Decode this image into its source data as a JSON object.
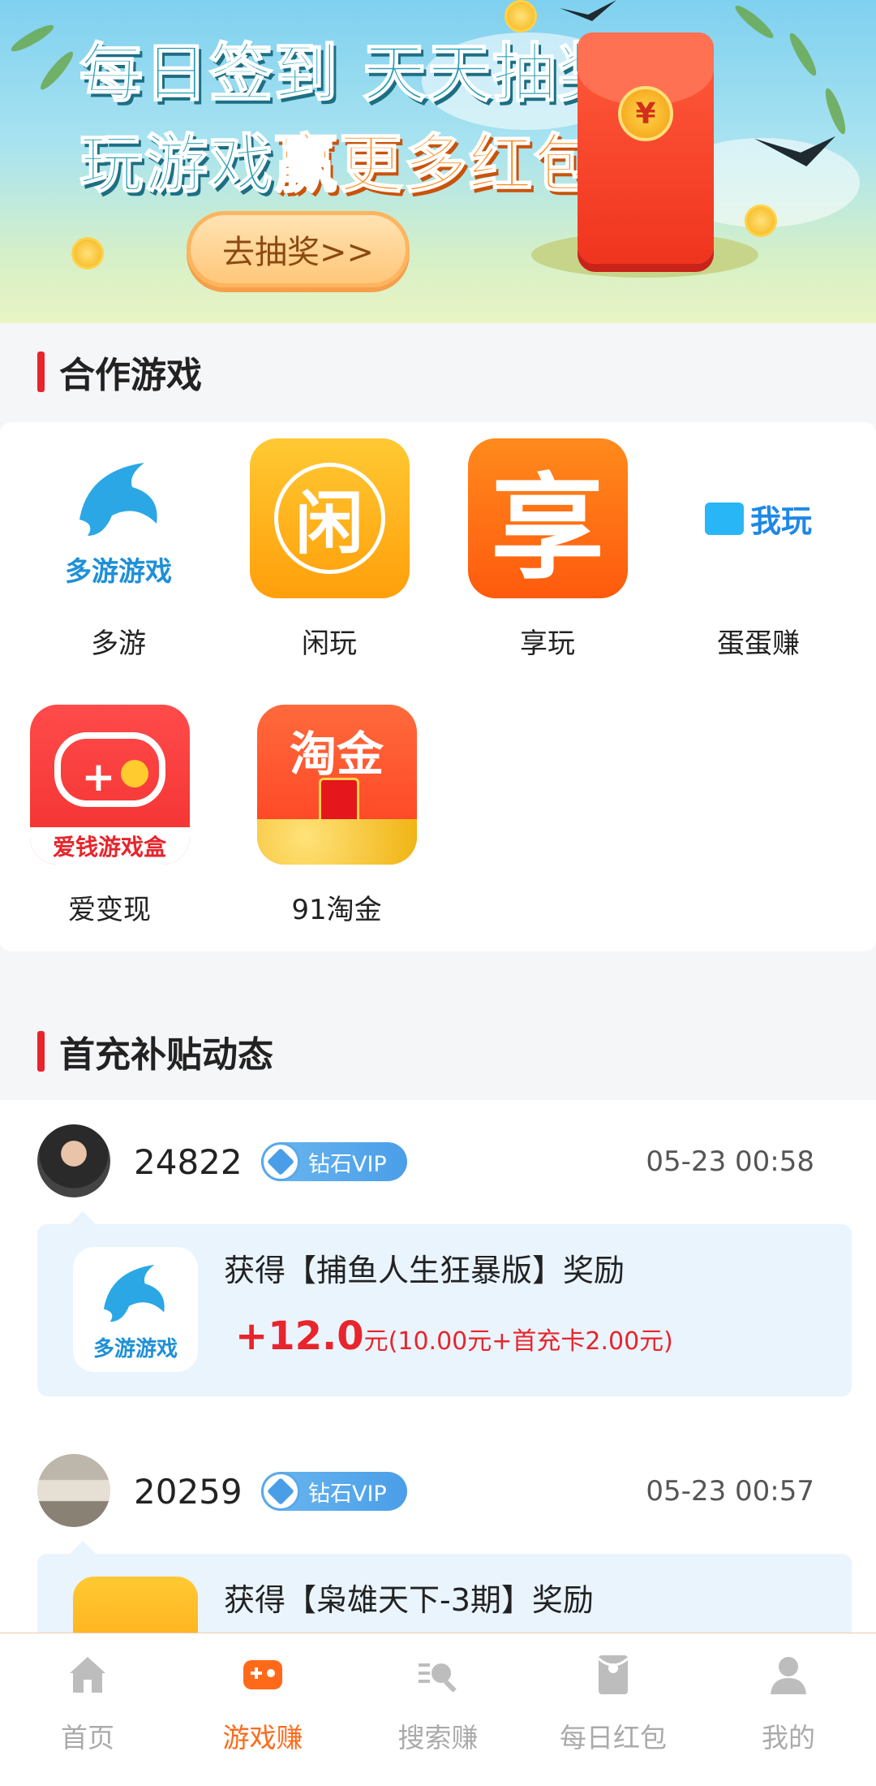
{
  "banner": {
    "line1": "每日签到 天天抽奖",
    "line2_a": "玩游戏",
    "line2_b": "赢更多红包",
    "cta": "去抽奖>>",
    "coin_symbol": "¥"
  },
  "games_section": {
    "title": "合作游戏",
    "items": [
      {
        "label": "多游",
        "icon": "duoyou-dolphin-icon",
        "icon_text": "多游游戏"
      },
      {
        "label": "闲玩",
        "icon": "xianwan-icon",
        "icon_text": "闲"
      },
      {
        "label": "享玩",
        "icon": "xiangwan-icon",
        "icon_text": "享"
      },
      {
        "label": "蛋蛋赚",
        "icon": "wowan-icon",
        "icon_text": "我玩"
      },
      {
        "label": "爱变现",
        "icon": "aibianxian-gamepad-icon",
        "icon_text": "爱钱游戏盒"
      },
      {
        "label": "91淘金",
        "icon": "taojin-icon",
        "icon_text": "淘金"
      }
    ]
  },
  "feed_section": {
    "title": "首充补贴动态",
    "items": [
      {
        "user_id": "24822",
        "vip": "钻石VIP",
        "time": "05-23 00:58",
        "reward_text": "获得【捕鱼人生狂暴版】奖励",
        "amount": "+12.0",
        "amount_detail": "元(10.00元+首充卡2.00元)",
        "game_icon_text": "多游游戏"
      },
      {
        "user_id": "20259",
        "vip": "钻石VIP",
        "time": "05-23 00:57",
        "reward_text": "获得【枭雄天下-3期】奖励"
      }
    ]
  },
  "tabbar": {
    "tabs": [
      {
        "label": "首页",
        "icon": "home-icon",
        "active": false
      },
      {
        "label": "游戏赚",
        "icon": "gamepad-icon",
        "active": true
      },
      {
        "label": "搜索赚",
        "icon": "search-list-icon",
        "active": false
      },
      {
        "label": "每日红包",
        "icon": "red-packet-icon",
        "active": false
      },
      {
        "label": "我的",
        "icon": "user-icon",
        "active": false
      }
    ],
    "active_color": "#ff6a1a",
    "inactive_color": "#aaaaaa"
  },
  "colors": {
    "accent_red": "#e8242c",
    "reward_bg": "#eaf4fd",
    "vip_blue": "#4a9ee8"
  }
}
